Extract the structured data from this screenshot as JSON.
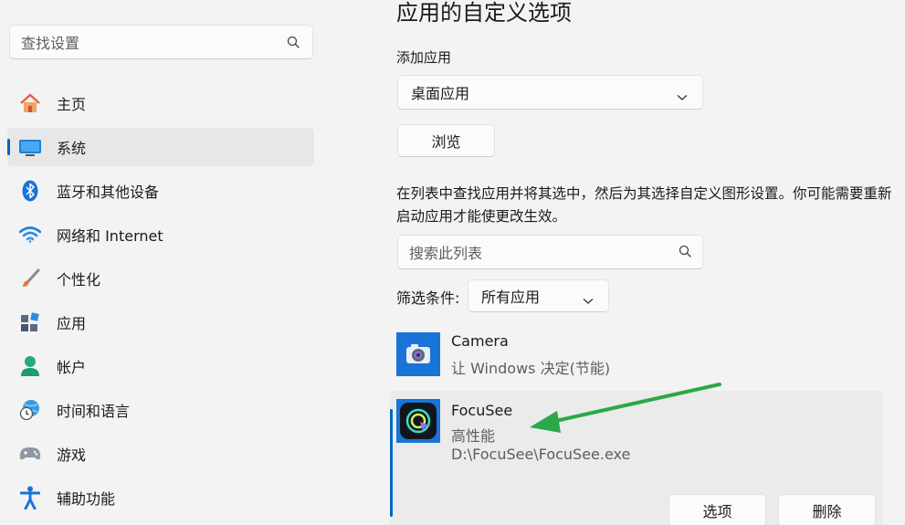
{
  "sidebar": {
    "search_placeholder": "查找设置",
    "items": [
      {
        "label": "主页",
        "icon": "home-icon"
      },
      {
        "label": "系统",
        "icon": "system-icon",
        "selected": true
      },
      {
        "label": "蓝牙和其他设备",
        "icon": "bluetooth-icon"
      },
      {
        "label": "网络和 Internet",
        "icon": "wifi-icon"
      },
      {
        "label": "个性化",
        "icon": "brush-icon"
      },
      {
        "label": "应用",
        "icon": "apps-icon"
      },
      {
        "label": "帐户",
        "icon": "account-icon"
      },
      {
        "label": "时间和语言",
        "icon": "time-language-icon"
      },
      {
        "label": "游戏",
        "icon": "gamepad-icon"
      },
      {
        "label": "辅助功能",
        "icon": "accessibility-icon"
      }
    ]
  },
  "main": {
    "title": "应用的自定义选项",
    "add_app_label": "添加应用",
    "app_type_selected": "桌面应用",
    "browse_label": "浏览",
    "description": "在列表中查找应用并将其选中，然后为其选择自定义图形设置。你可能需要重新启动应用才能使更改生效。",
    "list_search_placeholder": "搜索此列表",
    "filter_label": "筛选条件:",
    "filter_selected": "所有应用",
    "apps": [
      {
        "name": "Camera",
        "setting": "让 Windows 决定(节能)",
        "icon": "camera-icon"
      },
      {
        "name": "FocuSee",
        "setting": "高性能",
        "path": "D:\\FocuSee\\FocuSee.exe",
        "icon": "focusee-icon"
      }
    ],
    "options_label": "选项",
    "delete_label": "删除"
  },
  "colors": {
    "accent": "#0067c0",
    "annotation_arrow": "#2aa84a",
    "background": "#f3f3f3"
  }
}
